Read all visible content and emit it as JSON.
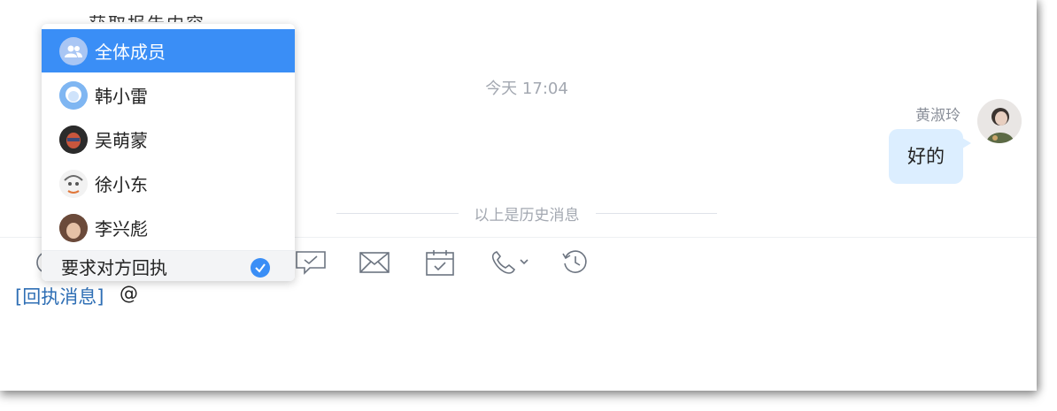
{
  "chat": {
    "partial_top_text": "获取报告内容",
    "timestamp": "今天 17:04",
    "sender_name": "黄淑玲",
    "message_text": "好的",
    "history_divider": "以上是历史消息"
  },
  "toolbar": {
    "tools": [
      "smiley-icon",
      "scissors-icon",
      "image-icon",
      "receipt-message-icon",
      "mail-icon",
      "calendar-check-icon",
      "phone-icon",
      "history-icon"
    ]
  },
  "editor": {
    "receipt_tag": "[回执消息]",
    "at_sign": "@"
  },
  "mention_dropdown": {
    "items": [
      {
        "label": "全体成员",
        "icon": "all-members-icon",
        "selected": true
      },
      {
        "label": "韩小雷",
        "icon": "avatar",
        "selected": false
      },
      {
        "label": "吴萌蒙",
        "icon": "avatar",
        "selected": false
      },
      {
        "label": "徐小东",
        "icon": "avatar",
        "selected": false
      },
      {
        "label": "李兴彪",
        "icon": "avatar",
        "selected": false
      }
    ],
    "footer_label": "要求对方回执",
    "footer_checked": true
  },
  "colors": {
    "accent": "#3a8ef6",
    "bubble": "#dceeff",
    "receipt_tag": "#2f6fb5",
    "muted_text": "#a3a8b1"
  }
}
